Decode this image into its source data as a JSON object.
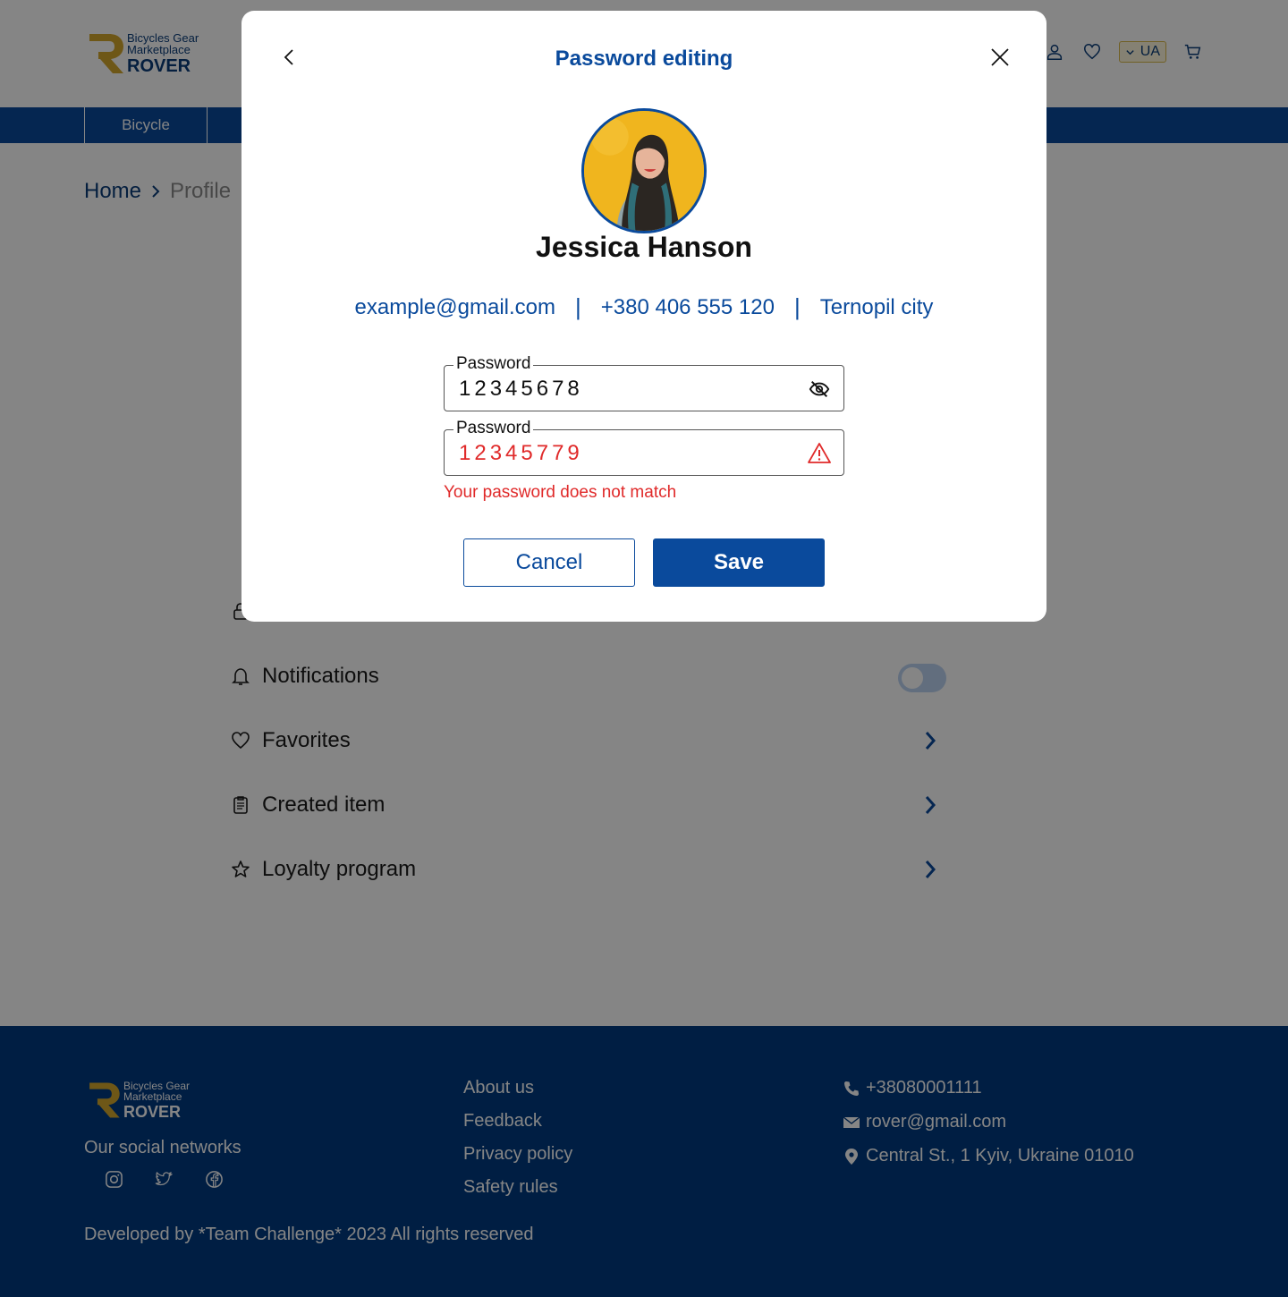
{
  "header": {
    "logo": {
      "line1": "Bicycles Gear",
      "line2": "Marketplace",
      "brand": "ROVER"
    },
    "language": "UA",
    "icons": [
      "user-icon",
      "heart-icon",
      "cart-icon"
    ]
  },
  "nav": {
    "items": [
      {
        "label": "Bicycle"
      }
    ]
  },
  "breadcrumb": {
    "home": "Home",
    "current": "Profile"
  },
  "profile_menu": {
    "items": [
      {
        "label": "Notifications",
        "icon": "bell-icon",
        "control": "toggle",
        "toggle_on": false
      },
      {
        "label": "Favorites",
        "icon": "heart-icon",
        "control": "chevron"
      },
      {
        "label": "Created item",
        "icon": "clipboard-icon",
        "control": "chevron"
      },
      {
        "label": "Loyalty program",
        "icon": "star-icon",
        "control": "chevron"
      }
    ]
  },
  "modal": {
    "title": "Password editing",
    "user": {
      "name": "Jessica Hanson",
      "email": "example@gmail.com",
      "phone": "+380 406 555 120",
      "city": "Ternopil city"
    },
    "fields": [
      {
        "label": "Password",
        "value": "12345678",
        "state": "normal",
        "icon": "eye-off-icon"
      },
      {
        "label": "Password",
        "value": "12345779",
        "state": "error",
        "icon": "warning-icon"
      }
    ],
    "error_message": "Your password does not match",
    "cancel_label": "Cancel",
    "save_label": "Save"
  },
  "footer": {
    "logo": {
      "line1": "Bicycles Gear",
      "line2": "Marketplace",
      "brand": "ROVER"
    },
    "social_title": "Our social networks",
    "socials": [
      "instagram-icon",
      "twitter-icon",
      "facebook-icon"
    ],
    "links": [
      "About us",
      "Feedback",
      "Privacy policy",
      "Safety rules"
    ],
    "contacts": {
      "phone": "+38080001111",
      "email": "rover@gmail.com",
      "address": "Central St., 1 Kyiv, Ukraine 01010"
    },
    "copyright": "Developed by *Team Challenge* 2023 All rights reserved"
  },
  "colors": {
    "primary": "#0a4a9c",
    "footer_bg": "#003a80",
    "logo_gold": "#d4a72c",
    "error": "#e02a2a"
  }
}
